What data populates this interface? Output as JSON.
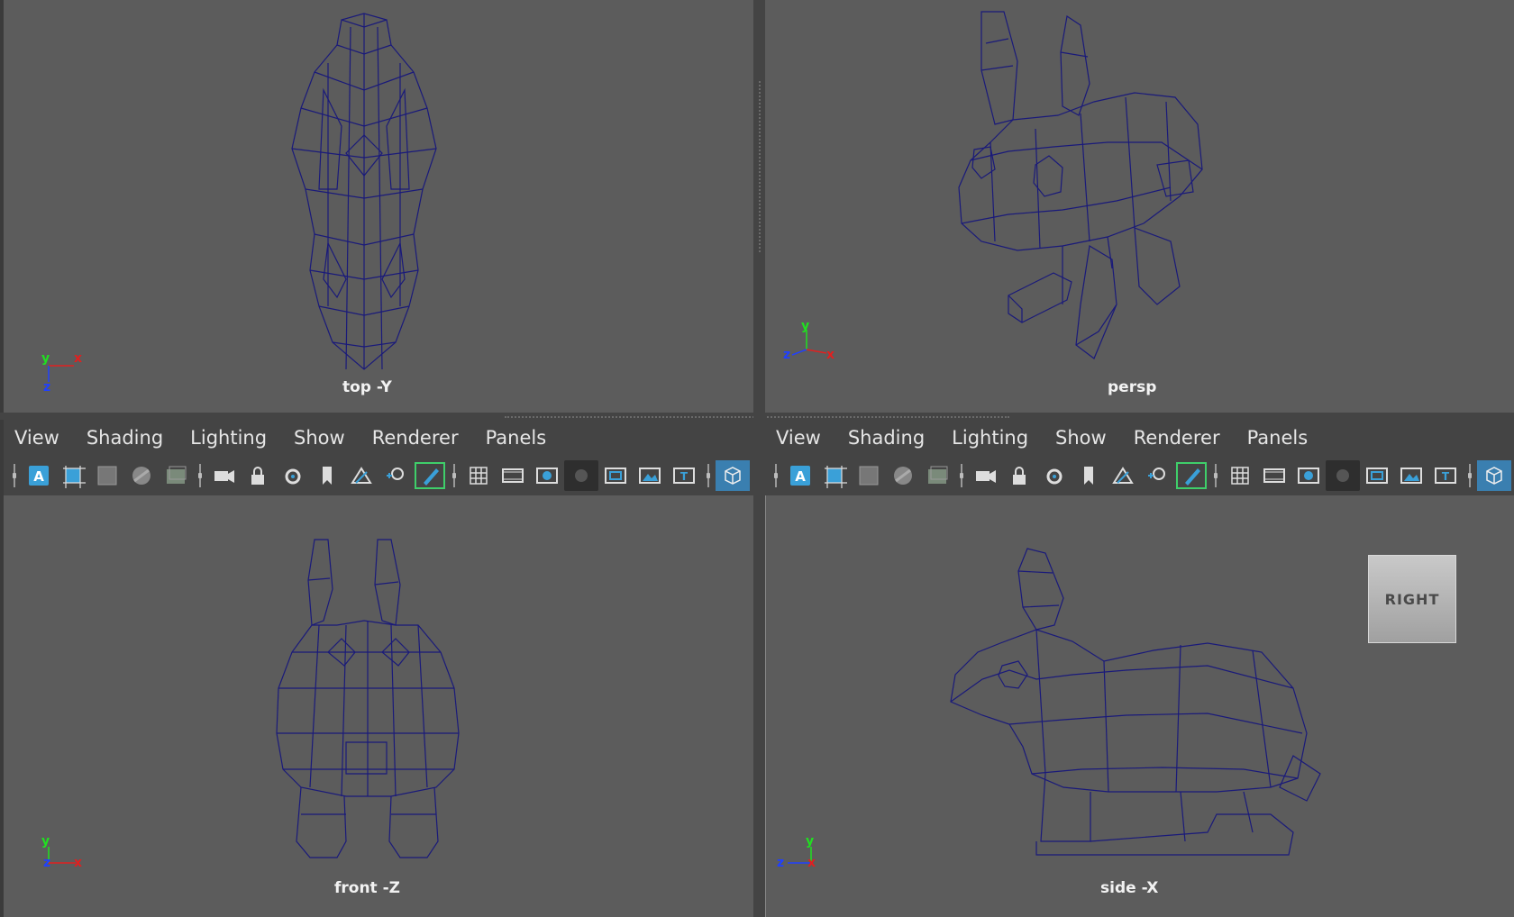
{
  "viewports": {
    "top": {
      "label": "top -Y"
    },
    "persp": {
      "label": "persp"
    },
    "front": {
      "label": "front -Z"
    },
    "side": {
      "label": "side -X"
    }
  },
  "axes": {
    "x": "x",
    "y": "y",
    "z": "z"
  },
  "panel_menu": {
    "view": "View",
    "shading": "Shading",
    "lighting": "Lighting",
    "show": "Show",
    "renderer": "Renderer",
    "panels": "Panels"
  },
  "toolbar_icons": [
    "select-camera-icon",
    "camera-attributes-icon",
    "bookmarks-icon",
    "image-plane-icon",
    "2d-pan-zoom-icon",
    "grease-pencil-icon",
    "grid-icon",
    "film-gate-icon",
    "resolution-gate-icon",
    "gate-mask-icon",
    "field-chart-icon",
    "safe-action-icon",
    "safe-title-icon",
    "isolate-select-icon"
  ],
  "viewcube": {
    "label": "RIGHT"
  },
  "colors": {
    "viewport_bg": "#5c5c5c",
    "wireframe": "#1a1a7a",
    "axis_x": "#e02020",
    "axis_y": "#20e020",
    "axis_z": "#2040ff",
    "highlight": "#3fcf6a"
  }
}
